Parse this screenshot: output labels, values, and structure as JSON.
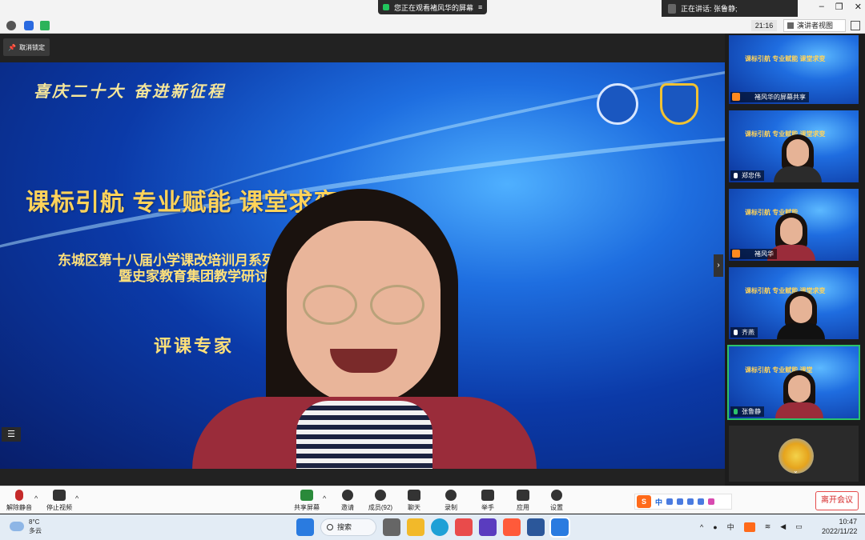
{
  "topbar": {
    "share_banner": "您正在观看褚风华的屏幕",
    "speaking": "正在讲话: 张鲁静;",
    "time": "21:16",
    "view_button": "演讲者视图",
    "unlock": "取消锁定"
  },
  "slide": {
    "header": "喜庆二十大 奋进新征程",
    "title": "课标引航 专业赋能 课堂求变",
    "sub1": "东城区第十八届小学课改培训月系列活",
    "sub2": "暨史家教育集团教学研讨会",
    "role": "评课专家"
  },
  "gallery": {
    "tiles": [
      {
        "name": "褚风华的屏幕共享",
        "title": "课标引航 专业赋能 课堂求变"
      },
      {
        "name": "郑忠伟",
        "title": "课标引航 专业赋能 课堂求变"
      },
      {
        "name": "褚风华",
        "title": "课标引航 专业赋能"
      },
      {
        "name": "齐燕",
        "title": "课标引航 专业赋能 课堂求变"
      },
      {
        "name": "张鲁静",
        "title": "课标引航 专业赋能 课堂"
      }
    ]
  },
  "controls": {
    "unmute": "解除静音",
    "stop_video": "停止视频",
    "share": "共享屏幕",
    "invite": "邀请",
    "members": "成员(92)",
    "chat": "聊天",
    "record": "录制",
    "raise_hand": "举手",
    "apps": "应用",
    "settings": "设置",
    "leave": "离开会议"
  },
  "ime": {
    "s": "S",
    "lang": "中"
  },
  "taskbar": {
    "temp": "8°C",
    "weather": "多云",
    "search": "搜索",
    "tray_lang": "中",
    "time": "10:47",
    "date": "2022/11/22"
  }
}
